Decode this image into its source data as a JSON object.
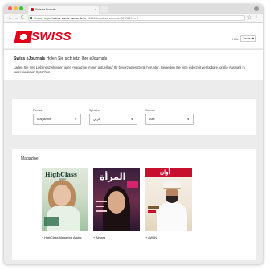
{
  "browser": {
    "tab_title": "Swiss eJournals",
    "tab_close": "×",
    "url_https": "Sicher | https://",
    "url_host": "mtoos.media-carrier.de",
    "url_path": "/#s-4815&download-account=0670831&u-4",
    "nav_back": "←",
    "nav_forward": "→",
    "nav_reload": "C",
    "star_icon": "☆",
    "menu_icon": "⋮"
  },
  "header": {
    "brand": "SWISS",
    "help": "Hilfe",
    "language": "Deutsch",
    "language_chevron": "▾"
  },
  "intro": {
    "title_bold": "Swiss eJournals",
    "title_rest": " Holen Sie sich jetzt Ihre eJournals",
    "text": "Laden Sie Ihre Lieblingszeitungen oder -magazine immer aktuell auf Ihr bevorzugtes Gerät herunter. Genießen Sie eine jederzeit verfügbare, große Auswahl in verschiedenen Sprachen."
  },
  "filters": {
    "format_label": "Format",
    "format_value": "Magazine",
    "language_label": "Sprache",
    "language_value": "عربي",
    "genre_label": "Genres",
    "genre_value": "Alle",
    "chevron": "∨"
  },
  "magazines": {
    "section_title": "Magazine",
    "items": [
      {
        "caption": "+ HighClass Magazine Arabic",
        "masthead": "HighClass",
        "subtitle": "Arabic"
      },
      {
        "caption": "+ Almara",
        "masthead": "المرأة"
      },
      {
        "caption": "+ AWAN",
        "masthead": "أوان"
      }
    ]
  },
  "colors": {
    "brand_red": "#e2001a",
    "page_bg": "#ececec"
  }
}
